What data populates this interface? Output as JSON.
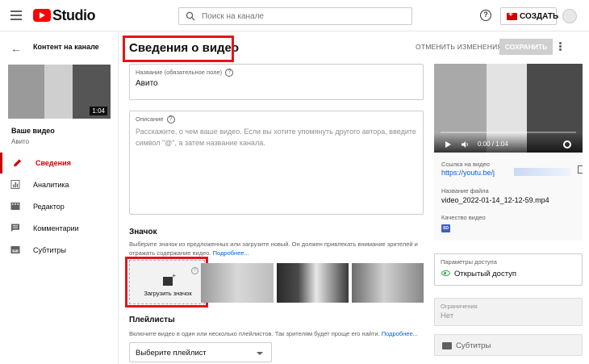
{
  "header": {
    "logo_text": "Studio",
    "search_placeholder": "Поиск на канале",
    "help_symbol": "?",
    "create_label": "СОЗДАТЬ"
  },
  "sidebar": {
    "back_title": "Контент на канале",
    "thumb_duration": "1:04",
    "video_title": "Ваше видео",
    "channel_name": "Авито",
    "nav": [
      {
        "label": "Сведения",
        "icon": "pencil-icon",
        "active": true
      },
      {
        "label": "Аналитика",
        "icon": "analytics-icon",
        "active": false
      },
      {
        "label": "Редактор",
        "icon": "editor-icon",
        "active": false
      },
      {
        "label": "Комментарии",
        "icon": "comments-icon",
        "active": false
      },
      {
        "label": "Субтитры",
        "icon": "subtitles-icon",
        "active": false
      }
    ]
  },
  "main": {
    "page_title": "Сведения о видео",
    "undo_label": "ОТМЕНИТЬ ИЗМЕНЕНИЯ",
    "save_label": "СОХРАНИТЬ",
    "title_field": {
      "label": "Название (обязательное поле)",
      "value": "Авито"
    },
    "description_field": {
      "label": "Описание",
      "placeholder": "Расскажите, о чем ваше видео. Если вы хотите упомянуть другого автора, введите символ \"@\", а затем название канала."
    },
    "thumbnail": {
      "heading": "Значок",
      "description": "Выберите значок из предложенных или загрузите новый. Он должен привлекать внимание зрителей и отражать содержание видео.",
      "more_link": "Подробнее...",
      "upload_label": "Загрузить значок"
    },
    "playlists": {
      "heading": "Плейлисты",
      "description": "Включите видео в один или несколько плейлистов. Так зрителям будет проще его найти.",
      "more_link": "Подробнее...",
      "select_value": "Выберите плейлист"
    }
  },
  "right_panel": {
    "player_time": "0:00 / 1:04",
    "link_label": "Ссылка на видео",
    "link_value": "https://youtu.be/j",
    "filename_label": "Название файла",
    "filename_value": "video_2022-01-14_12-12-59.mp4",
    "quality_label": "Качество видео",
    "quality_badge": "SD",
    "access_label": "Параметры доступа",
    "access_value": "Открытый доступ",
    "restrictions_label": "Ограничения",
    "restrictions_value": "Нет",
    "subtitles_label": "Субтитры"
  },
  "colors": {
    "accent_red": "#cc0000",
    "highlight_red": "#e4141b",
    "link_blue": "#065fd4",
    "public_green": "#2ba640"
  }
}
